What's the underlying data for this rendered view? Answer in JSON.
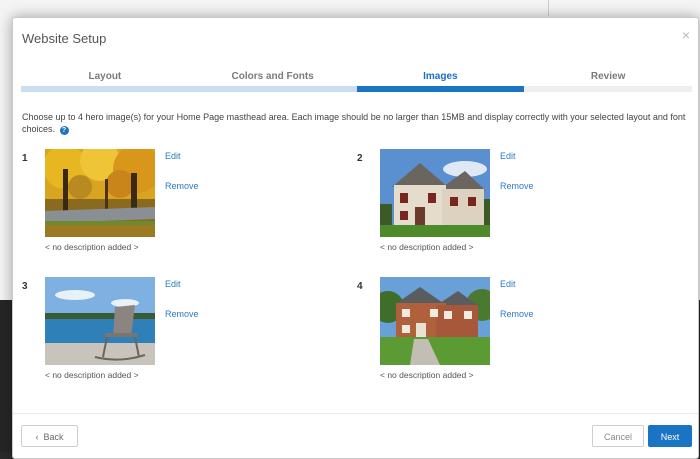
{
  "modal": {
    "title": "Website Setup",
    "close_glyph": "×"
  },
  "steps": [
    {
      "label": "Layout",
      "state": "done"
    },
    {
      "label": "Colors and Fonts",
      "state": "done"
    },
    {
      "label": "Images",
      "state": "active"
    },
    {
      "label": "Review",
      "state": "future"
    }
  ],
  "instructions": "Choose up to 4 hero image(s) for your Home Page masthead area. Each image should be no larger than 15MB and display correctly with your selected layout and font choices.",
  "help_glyph": "?",
  "slots": [
    {
      "number": "1",
      "edit": "Edit",
      "remove": "Remove",
      "description": "< no description added >",
      "image": "autumn-trees-street"
    },
    {
      "number": "2",
      "edit": "Edit",
      "remove": "Remove",
      "description": "< no description added >",
      "image": "suburban-house"
    },
    {
      "number": "3",
      "edit": "Edit",
      "remove": "Remove",
      "description": "< no description added >",
      "image": "rocking-chair-lake"
    },
    {
      "number": "4",
      "edit": "Edit",
      "remove": "Remove",
      "description": "< no description added >",
      "image": "brick-house"
    }
  ],
  "footer": {
    "back": "Back",
    "back_glyph": "‹",
    "cancel": "Cancel",
    "next": "Next"
  },
  "colors": {
    "accent": "#1a74c4",
    "step_done": "#c8dff2",
    "link": "#2b7ac9"
  }
}
